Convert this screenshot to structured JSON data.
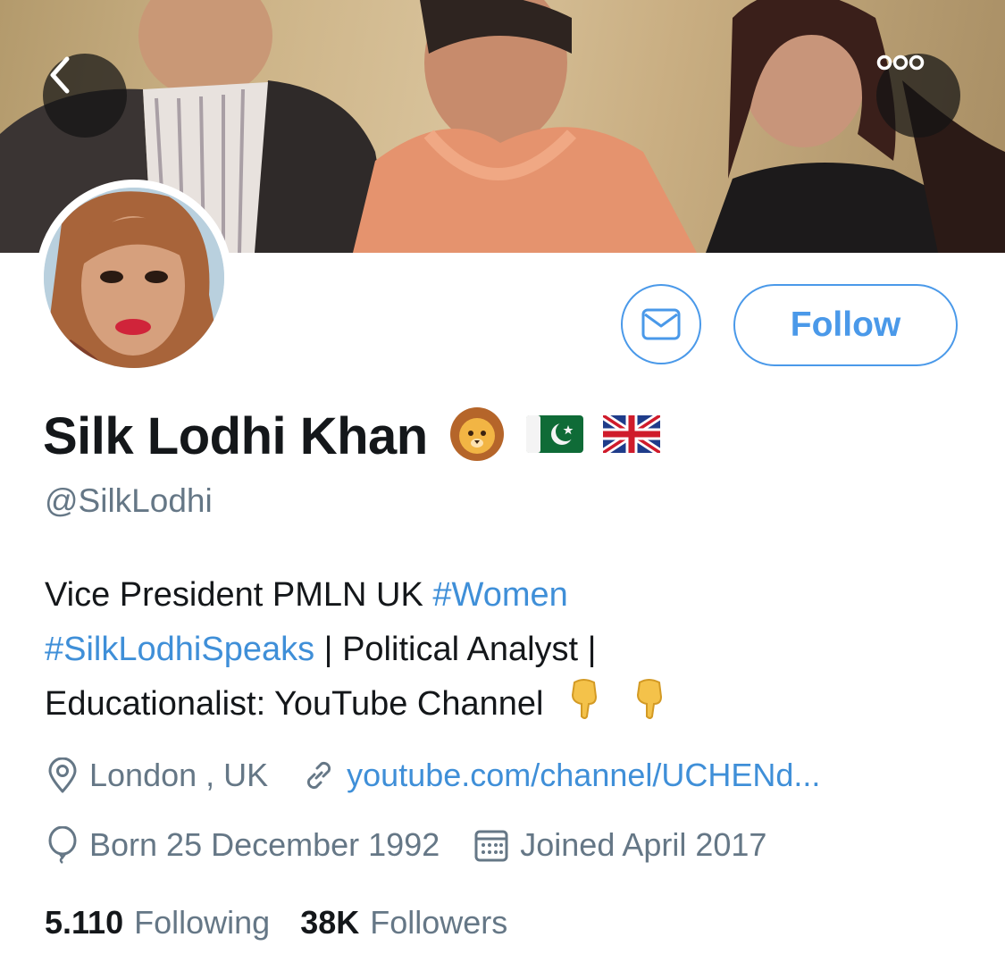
{
  "header": {
    "back_icon": "chevron-left-icon",
    "more_icon": "more-dots-icon"
  },
  "profile": {
    "display_name": "Silk Lodhi Khan",
    "name_emojis": [
      "lion-emoji",
      "pakistan-flag-emoji",
      "uk-flag-emoji"
    ],
    "handle": "@SilkLodhi",
    "follow_label": "Follow",
    "message_icon": "envelope-icon"
  },
  "bio": {
    "line1_text": "Vice President PMLN UK ",
    "line1_tag": "#Women",
    "line2_tag": "#SilkLodhiSpeaks",
    "line2_text": " | Political Analyst |",
    "line3_text": "Educationalist: YouTube Channel"
  },
  "meta": {
    "location": "London , UK",
    "website": "youtube.com/channel/UCHENd...",
    "birthday": "Born 25 December 1992",
    "joined": "Joined April 2017"
  },
  "stats": {
    "following_count": "5.110",
    "following_label": "Following",
    "followers_count": "38K",
    "followers_label": "Followers"
  },
  "colors": {
    "accent": "#4a99e9",
    "link": "#3f8fd8",
    "text_primary": "#14171a",
    "text_secondary": "#657786"
  }
}
